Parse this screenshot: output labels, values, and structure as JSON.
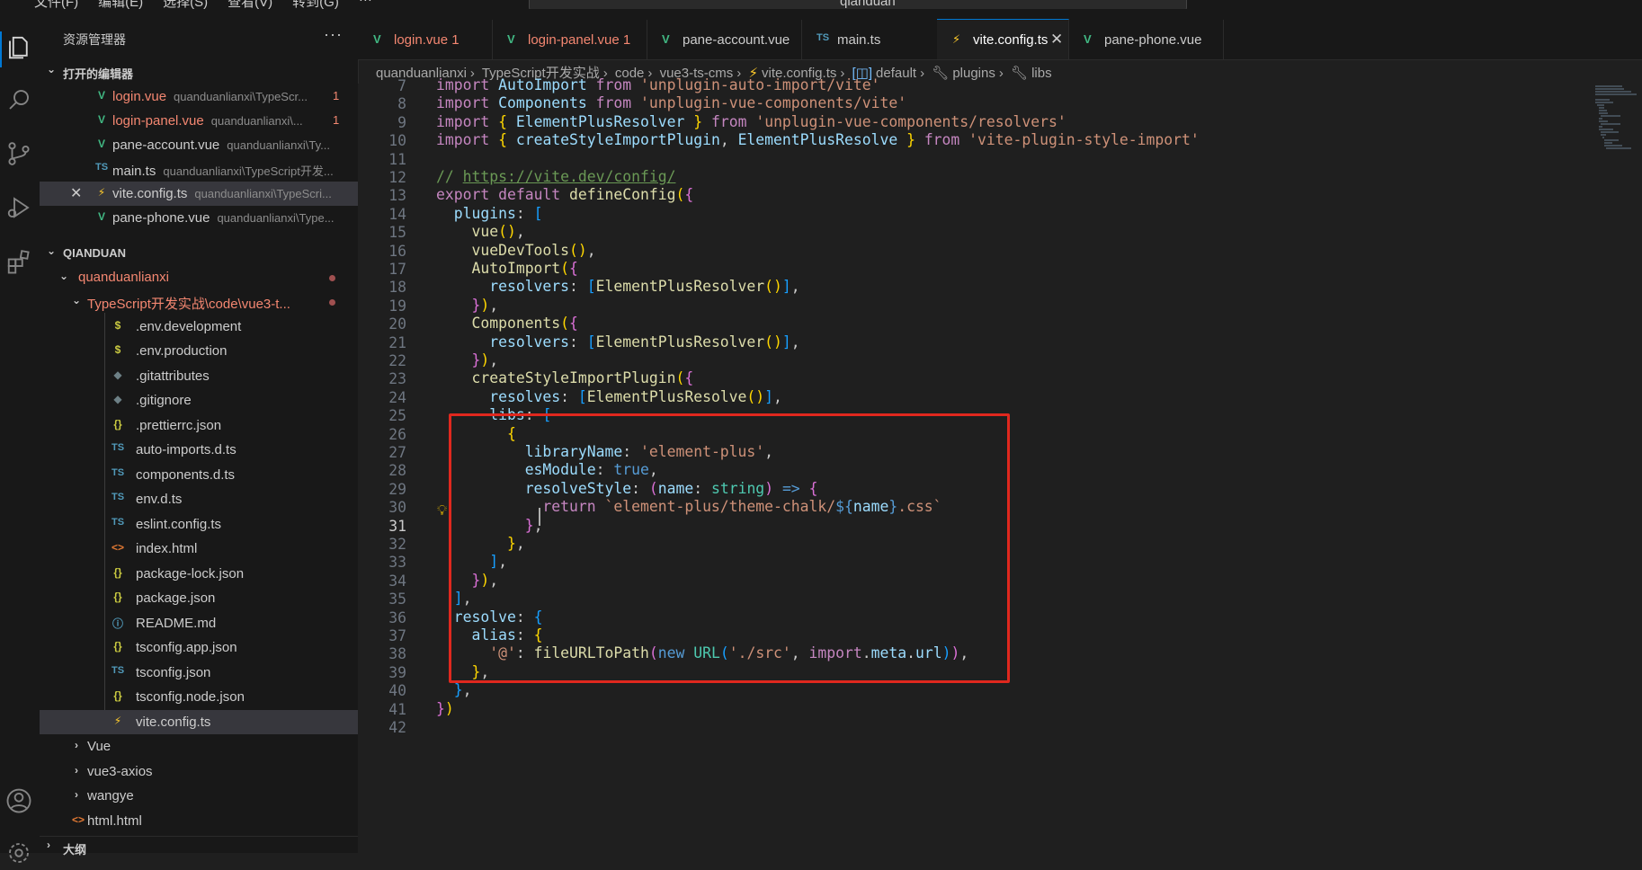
{
  "menu": [
    "文件(F)",
    "编辑(E)",
    "选择(S)",
    "查看(V)",
    "转到(G)",
    "···"
  ],
  "search": {
    "text": "qianduan"
  },
  "sidebar": {
    "title": "资源管理器",
    "more": "···",
    "open_editors_label": "打开的编辑器",
    "open_editors": [
      {
        "icon": "V",
        "name": "login.vue",
        "path": "quanduanlianxi\\TypeScr...",
        "badge": "1"
      },
      {
        "icon": "V",
        "name": "login-panel.vue",
        "path": "quanduanlianxi\\...",
        "badge": "1"
      },
      {
        "icon": "V",
        "name": "pane-account.vue",
        "path": "quanduanlianxi\\Ty...",
        "badge": ""
      },
      {
        "icon": "TS",
        "name": "main.ts",
        "path": "quanduanlianxi\\TypeScript开发...",
        "badge": ""
      },
      {
        "icon": "⚡",
        "name": "vite.config.ts",
        "path": "quanduanlianxi\\TypeScri...",
        "badge": ""
      },
      {
        "icon": "V",
        "name": "pane-phone.vue",
        "path": "quanduanlianxi\\Type...",
        "badge": ""
      }
    ],
    "workspace_label": "QIANDUAN",
    "folder1": "quanduanlianxi",
    "folder2": "TypeScript开发实战\\code\\vue3-t...",
    "files": [
      {
        "icon": "$",
        "name": ".env.development"
      },
      {
        "icon": "$",
        "name": ".env.production"
      },
      {
        "icon": "◆",
        "name": ".gitattributes"
      },
      {
        "icon": "◆",
        "name": ".gitignore"
      },
      {
        "icon": "{}",
        "name": ".prettierrc.json"
      },
      {
        "icon": "TS",
        "name": "auto-imports.d.ts"
      },
      {
        "icon": "TS",
        "name": "components.d.ts"
      },
      {
        "icon": "TS",
        "name": "env.d.ts"
      },
      {
        "icon": "TS",
        "name": "eslint.config.ts"
      },
      {
        "icon": "<>",
        "name": "index.html"
      },
      {
        "icon": "{}",
        "name": "package-lock.json"
      },
      {
        "icon": "{}",
        "name": "package.json"
      },
      {
        "icon": "ⓘ",
        "name": "README.md"
      },
      {
        "icon": "{}",
        "name": "tsconfig.app.json"
      },
      {
        "icon": "TS",
        "name": "tsconfig.json"
      },
      {
        "icon": "{}",
        "name": "tsconfig.node.json"
      },
      {
        "icon": "⚡",
        "name": "vite.config.ts"
      }
    ],
    "folders": [
      "Vue",
      "vue3-axios",
      "wangye"
    ],
    "html_file": "html.html",
    "outline_label": "大纲"
  },
  "tabs": [
    {
      "icon": "V",
      "label": "login.vue",
      "badge": "1"
    },
    {
      "icon": "V",
      "label": "login-panel.vue",
      "badge": "1"
    },
    {
      "icon": "V",
      "label": "pane-account.vue",
      "badge": ""
    },
    {
      "icon": "TS",
      "label": "main.ts",
      "badge": ""
    },
    {
      "icon": "⚡",
      "label": "vite.config.ts",
      "badge": ""
    },
    {
      "icon": "V",
      "label": "pane-phone.vue",
      "badge": ""
    }
  ],
  "breadcrumb": [
    "quanduanlianxi",
    "TypeScript开发实战",
    "code",
    "vue3-ts-cms",
    "vite.config.ts",
    "default",
    "plugins",
    "libs"
  ],
  "code": {
    "current_line": 31,
    "lines": [
      {
        "n": 7,
        "t": "import AutoImport from 'unplugin-auto-import/vite'"
      },
      {
        "n": 8,
        "t": "import Components from 'unplugin-vue-components/vite'"
      },
      {
        "n": 9,
        "t": "import { ElementPlusResolver } from 'unplugin-vue-components/resolvers'"
      },
      {
        "n": 10,
        "t": "import { createStyleImportPlugin, ElementPlusResolve } from 'vite-plugin-style-import'"
      },
      {
        "n": 11,
        "t": ""
      },
      {
        "n": 12,
        "t": "// https://vite.dev/config/"
      },
      {
        "n": 13,
        "t": "export default defineConfig({"
      },
      {
        "n": 14,
        "t": "  plugins: ["
      },
      {
        "n": 15,
        "t": "    vue(),"
      },
      {
        "n": 16,
        "t": "    vueDevTools(),"
      },
      {
        "n": 17,
        "t": "    AutoImport({"
      },
      {
        "n": 18,
        "t": "      resolvers: [ElementPlusResolver()],"
      },
      {
        "n": 19,
        "t": "    }),"
      },
      {
        "n": 20,
        "t": "    Components({"
      },
      {
        "n": 21,
        "t": "      resolvers: [ElementPlusResolver()],"
      },
      {
        "n": 22,
        "t": "    }),"
      },
      {
        "n": 23,
        "t": "    createStyleImportPlugin({"
      },
      {
        "n": 24,
        "t": "      resolves: [ElementPlusResolve()],"
      },
      {
        "n": 25,
        "t": "      libs: ["
      },
      {
        "n": 26,
        "t": "        {"
      },
      {
        "n": 27,
        "t": "          libraryName: 'element-plus',"
      },
      {
        "n": 28,
        "t": "          esModule: true,"
      },
      {
        "n": 29,
        "t": "          resolveStyle: (name: string) => {"
      },
      {
        "n": 30,
        "t": "            return `element-plus/theme-chalk/${name}.css`"
      },
      {
        "n": 31,
        "t": "          },"
      },
      {
        "n": 32,
        "t": "        },"
      },
      {
        "n": 33,
        "t": "      ],"
      },
      {
        "n": 34,
        "t": "    }),"
      },
      {
        "n": 35,
        "t": "  ],"
      },
      {
        "n": 36,
        "t": "  resolve: {"
      },
      {
        "n": 37,
        "t": "    alias: {"
      },
      {
        "n": 38,
        "t": "      '@': fileURLToPath(new URL('./src', import.meta.url)),"
      },
      {
        "n": 39,
        "t": "    },"
      },
      {
        "n": 40,
        "t": "  },"
      },
      {
        "n": 41,
        "t": "})"
      },
      {
        "n": 42,
        "t": ""
      }
    ]
  },
  "colors": {
    "vue_icon": "#41b883",
    "ts_icon": "#519aba",
    "modified_red": "#f48771",
    "highlight_box": "#e0281e",
    "accent": "#0078d4"
  }
}
